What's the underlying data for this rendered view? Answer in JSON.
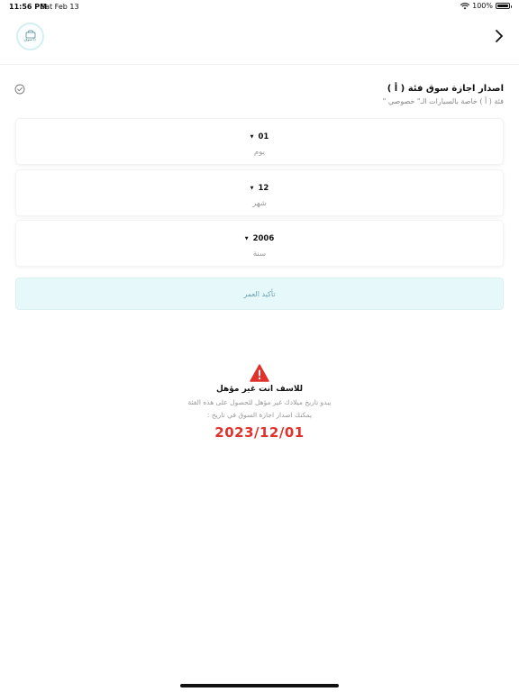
{
  "status_bar": {
    "time": "11:56 PM",
    "date": "Sat Feb 13",
    "battery": "100%",
    "battery_level": 1.0
  },
  "header": {
    "logo_text": "ذا سوق",
    "back_icon": "chevron-right-icon"
  },
  "section": {
    "title": "اصدار اجازة سوق فئة ( أ )",
    "subtitle": "فئة ( أ ) خاصة بالسيارات الـ\" خصوصي \"",
    "check_icon": "check-circle-icon"
  },
  "pickers": {
    "day": {
      "value": "01",
      "label": "يوم"
    },
    "month": {
      "value": "12",
      "label": "شهر"
    },
    "year": {
      "value": "2006",
      "label": "سنة"
    }
  },
  "confirm_button": {
    "label": "تأكيد العمر"
  },
  "warning": {
    "icon": "warning-icon",
    "title": "للاسف انت غير مؤهل",
    "line1": "يبدو تاريخ ميلادك غير مؤهل للحصول على هذه الفئة",
    "line2": "يمكنك اصدار اجازة السوق في تاريخ :",
    "date": "2023/12/01"
  },
  "colors": {
    "accent_light": "#e6f8f9",
    "accent_text": "#6ba3b1",
    "error": "#e1312b"
  }
}
